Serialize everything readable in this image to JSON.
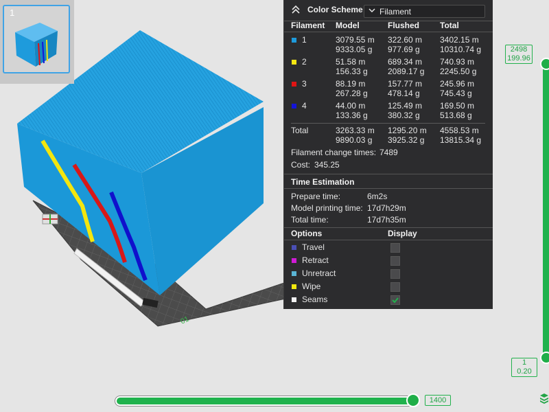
{
  "plate": {
    "number": "1"
  },
  "legend": {
    "color_scheme_label": "Color Scheme",
    "color_scheme_value": "Filament",
    "headers": {
      "filament": "Filament",
      "model": "Model",
      "flushed": "Flushed",
      "total": "Total"
    },
    "filaments": [
      {
        "id": "1",
        "color": "#1e9bdc",
        "model_m": "3079.55 m",
        "model_g": "9333.05 g",
        "flushed_m": "322.60 m",
        "flushed_g": "977.69 g",
        "total_m": "3402.15 m",
        "total_g": "10310.74 g"
      },
      {
        "id": "2",
        "color": "#f5e612",
        "model_m": "51.58 m",
        "model_g": "156.33 g",
        "flushed_m": "689.34 m",
        "flushed_g": "2089.17 g",
        "total_m": "740.93 m",
        "total_g": "2245.50 g"
      },
      {
        "id": "3",
        "color": "#e01414",
        "model_m": "88.19 m",
        "model_g": "267.28 g",
        "flushed_m": "157.77 m",
        "flushed_g": "478.14 g",
        "total_m": "245.96 m",
        "total_g": "745.43 g"
      },
      {
        "id": "4",
        "color": "#1414d8",
        "model_m": "44.00 m",
        "model_g": "133.36 g",
        "flushed_m": "125.49 m",
        "flushed_g": "380.32 g",
        "total_m": "169.50 m",
        "total_g": "513.68 g"
      }
    ],
    "total": {
      "label": "Total",
      "model_m": "3263.33 m",
      "model_g": "9890.03 g",
      "flushed_m": "1295.20 m",
      "flushed_g": "3925.32 g",
      "total_m": "4558.53 m",
      "total_g": "13815.34 g"
    },
    "filament_change_label": "Filament change times:",
    "filament_change_value": "7489",
    "cost_label": "Cost:",
    "cost_value": "345.25",
    "time_title": "Time Estimation",
    "prepare_label": "Prepare time:",
    "prepare_value": "6m2s",
    "model_time_label": "Model printing time:",
    "model_time_value": "17d7h29m",
    "total_time_label": "Total time:",
    "total_time_value": "17d7h35m",
    "options_title": "Options",
    "display_title": "Display",
    "options": [
      {
        "label": "Travel",
        "color": "#4a4fb5",
        "checked": false
      },
      {
        "label": "Retract",
        "color": "#d01bd6",
        "checked": false
      },
      {
        "label": "Unretract",
        "color": "#5ab4d4",
        "checked": false
      },
      {
        "label": "Wipe",
        "color": "#f2e80f",
        "checked": false
      },
      {
        "label": "Seams",
        "color": "#f2f2f2",
        "checked": true
      }
    ]
  },
  "vertical_slider": {
    "top_layer": "2498",
    "top_height": "199.96",
    "bottom_layer": "1",
    "bottom_height": "0.20"
  },
  "horizontal_slider": {
    "value": "1400"
  },
  "colors": {
    "accent_green": "#20b24d",
    "model_blue": "#1e9bdc"
  }
}
